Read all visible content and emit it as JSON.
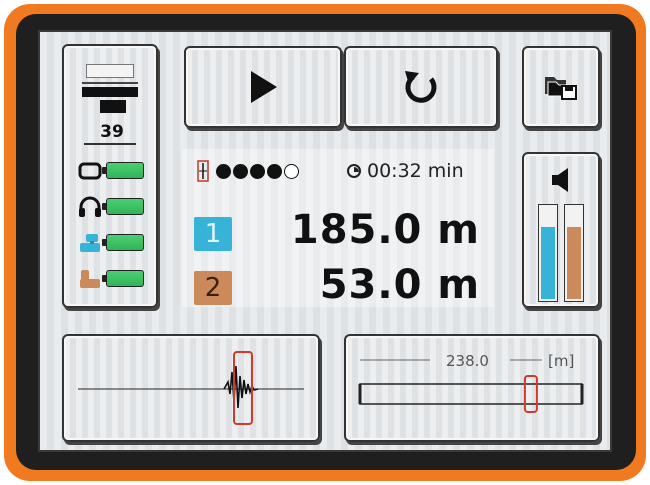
{
  "device": {
    "colors": {
      "frame": "#f17a21",
      "bezel": "#1f1f1f",
      "channel1": "#36b3d6",
      "channel2": "#cc8a5b",
      "battery": "#3cc266"
    }
  },
  "status_panel": {
    "count": "39",
    "devices": [
      {
        "icon": "receiver-unit-icon",
        "battery": 1.0
      },
      {
        "icon": "headphones-icon",
        "battery": 1.0
      },
      {
        "icon": "sensor-1-icon",
        "battery": 1.0
      },
      {
        "icon": "sensor-2-icon",
        "battery": 1.0
      }
    ]
  },
  "toolbar": {
    "play_icon": "play-icon",
    "reset_icon": "refresh-icon",
    "file_icon": "folder-save-icon"
  },
  "readout": {
    "signal_dots_filled": 4,
    "signal_dots_total": 5,
    "timer": "00:32 min",
    "channel1_label": "1",
    "channel1_distance": "185.0 m",
    "channel2_label": "2",
    "channel2_distance": "53.0 m"
  },
  "volume": {
    "icon": "speaker-icon",
    "level_channel1": 0.78,
    "level_channel2": 0.78
  },
  "scale": {
    "length": "238.0",
    "unit": "[m]",
    "marker_position": 0.77
  }
}
